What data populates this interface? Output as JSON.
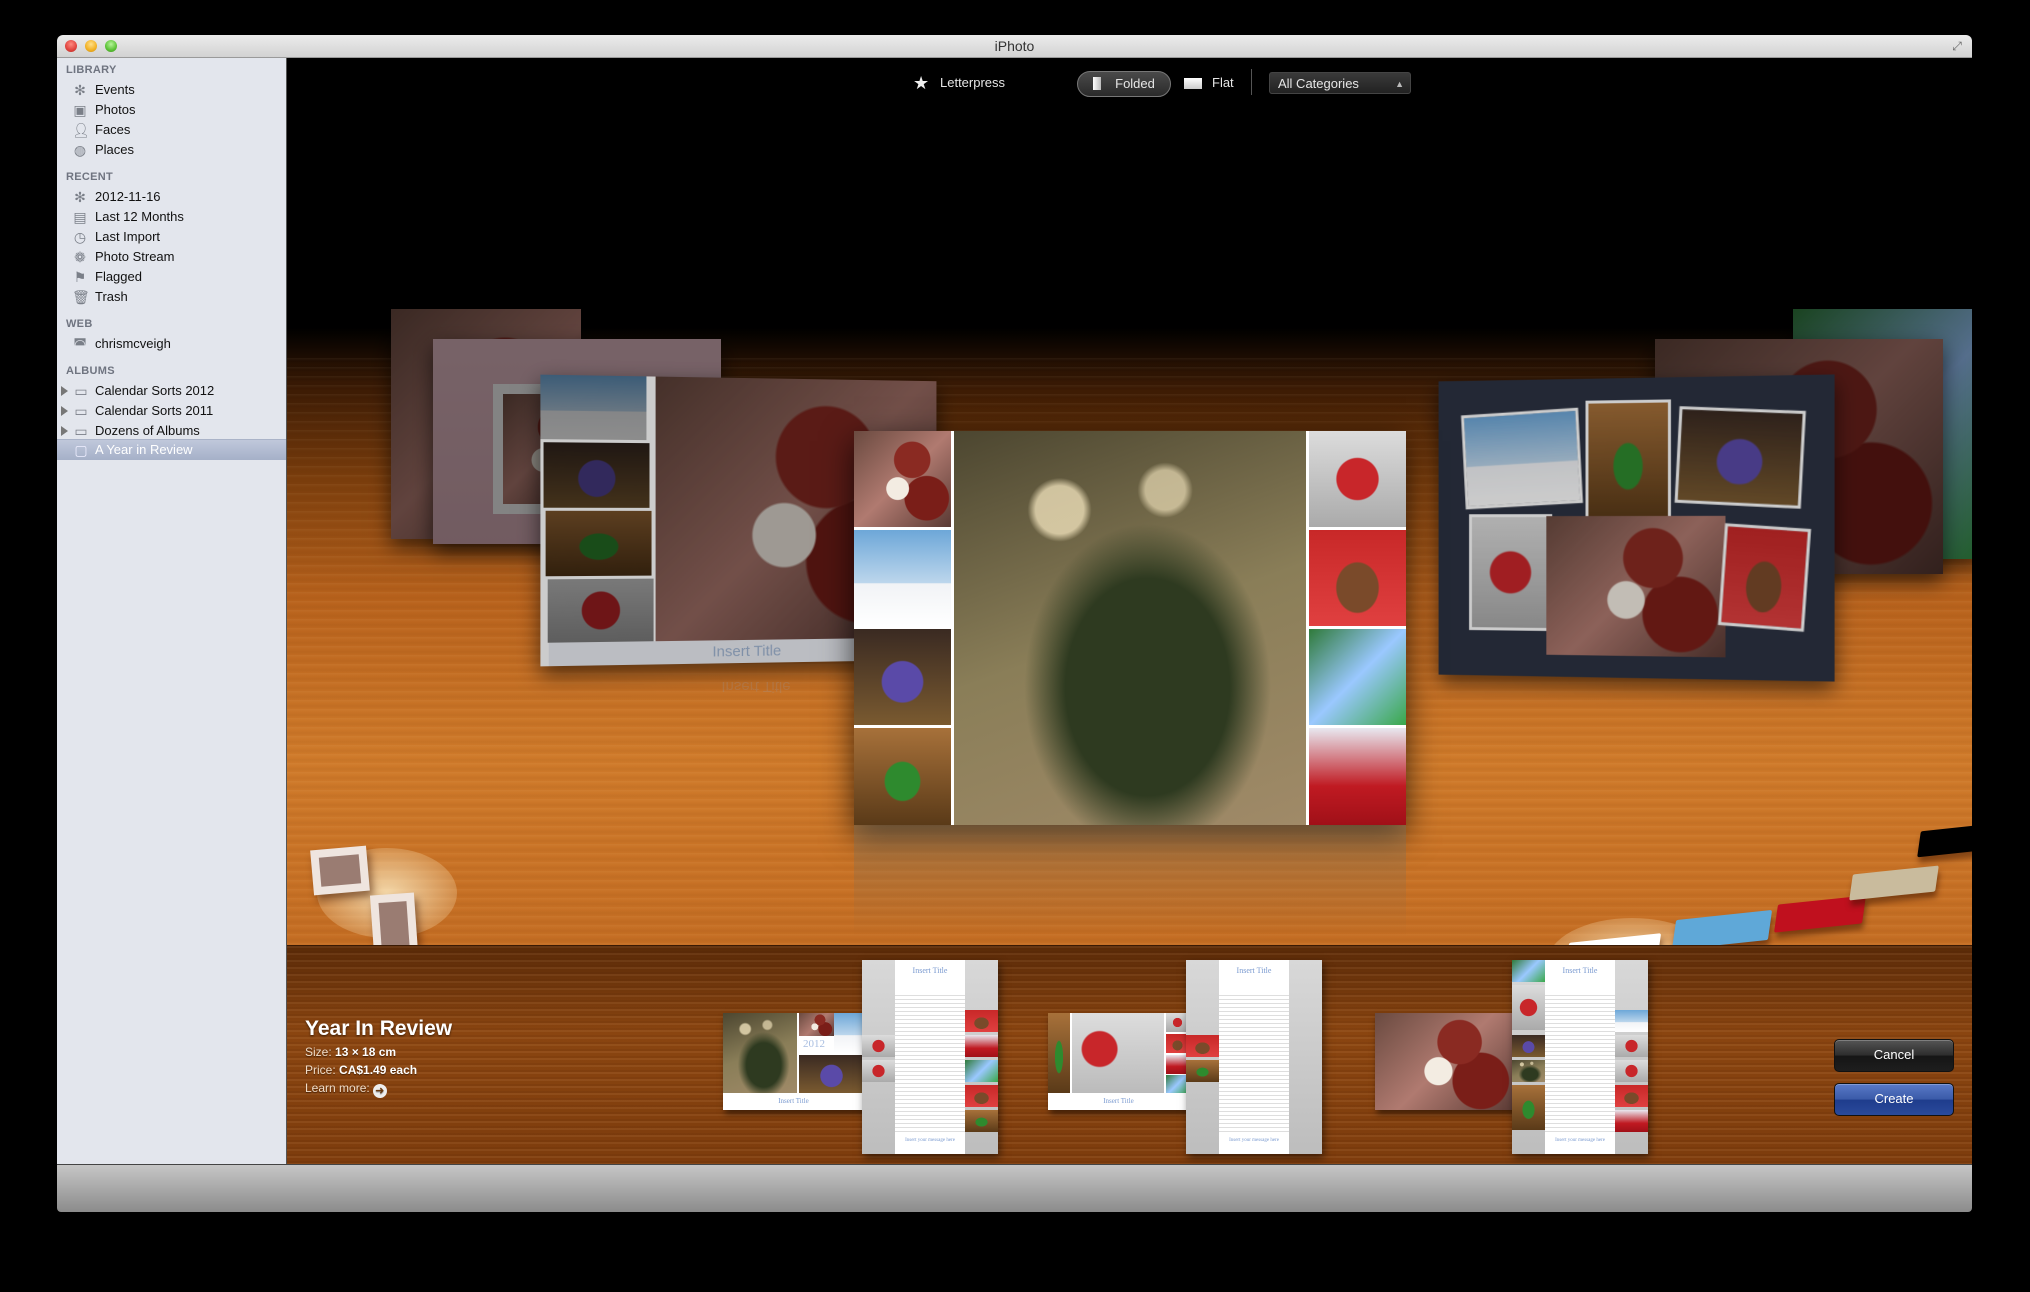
{
  "window": {
    "title": "iPhoto"
  },
  "sidebar": {
    "sections": [
      {
        "heading": "LIBRARY",
        "items": [
          {
            "label": "Events",
            "icon": "palm-tree-icon"
          },
          {
            "label": "Photos",
            "icon": "photo-frame-icon"
          },
          {
            "label": "Faces",
            "icon": "person-icon"
          },
          {
            "label": "Places",
            "icon": "globe-icon"
          }
        ]
      },
      {
        "heading": "RECENT",
        "items": [
          {
            "label": "2012-11-16",
            "icon": "palm-tree-icon"
          },
          {
            "label": "Last 12 Months",
            "icon": "calendar-icon"
          },
          {
            "label": "Last Import",
            "icon": "clock-icon"
          },
          {
            "label": "Photo Stream",
            "icon": "photo-stream-icon"
          },
          {
            "label": "Flagged",
            "icon": "flag-icon"
          },
          {
            "label": "Trash",
            "icon": "trash-icon"
          }
        ]
      },
      {
        "heading": "WEB",
        "items": [
          {
            "label": "chrismcveigh",
            "icon": "web-album-icon"
          }
        ]
      },
      {
        "heading": "ALBUMS",
        "items": [
          {
            "label": "Calendar Sorts 2012",
            "icon": "folder-icon",
            "expandable": true
          },
          {
            "label": "Calendar Sorts 2011",
            "icon": "folder-icon",
            "expandable": true
          },
          {
            "label": "Dozens of Albums",
            "icon": "folder-icon",
            "expandable": true
          },
          {
            "label": "A Year in Review",
            "icon": "album-icon",
            "selected": true
          }
        ]
      }
    ]
  },
  "toolbar": {
    "letterpress_label": "Letterpress",
    "folded_label": "Folded",
    "flat_label": "Flat",
    "selected_style": "Folded",
    "category_value": "All Categories"
  },
  "stage": {
    "insert_title": "Insert Title",
    "paper_colors": [
      "#ffffff",
      "#5fa8d8",
      "#c0101e",
      "#c9bb9d",
      "#000000"
    ],
    "selected_paper_color": "#ffffff"
  },
  "details": {
    "theme_name": "Year In Review",
    "size_label": "Size:",
    "size_value": "13 × 18 cm",
    "price_label": "Price:",
    "price_value": "CA$1.49 each",
    "learn_more": "Learn more:"
  },
  "previews": [
    {
      "front_caption": "Insert Title",
      "year_text": "2012",
      "page_title": "Insert Title",
      "page_footer": "Insert your message here"
    },
    {
      "front_caption": "Insert Title",
      "page_title": "Insert Title",
      "page_footer": "Insert your message here"
    },
    {
      "page_title": "Insert Title",
      "page_footer": "Insert your message here"
    }
  ],
  "buttons": {
    "cancel": "Cancel",
    "create": "Create"
  },
  "colors": {
    "create_button": "#2a4a9c",
    "selection": "#a5b0c8",
    "wood": "#c46d23"
  }
}
